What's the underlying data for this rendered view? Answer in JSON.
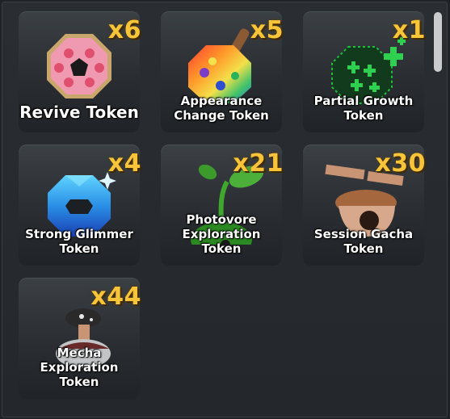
{
  "inventory": {
    "items": [
      {
        "name": "Revive Token",
        "count": "x6",
        "icon": "pink-octagon-donut-icon"
      },
      {
        "name": "Appearance\nChange Token",
        "count": "x5",
        "icon": "rainbow-paint-palette-icon"
      },
      {
        "name": "Partial Growth\nToken",
        "count": "x1",
        "icon": "green-plus-orb-icon"
      },
      {
        "name": "Strong Glimmer\nToken",
        "count": "x4",
        "icon": "blue-crystal-octagon-icon"
      },
      {
        "name": "Photovore\nExploration Token",
        "count": "x21",
        "icon": "sprout-orb-icon"
      },
      {
        "name": "Session Gacha\nToken",
        "count": "x30",
        "icon": "acorn-propeller-icon"
      },
      {
        "name": "Mecha Exploration\nToken",
        "count": "x44",
        "icon": "mushroom-robot-icon"
      }
    ]
  },
  "colors": {
    "count": "#f7c43a",
    "card": "#2f3338",
    "background": "#1f2226"
  }
}
